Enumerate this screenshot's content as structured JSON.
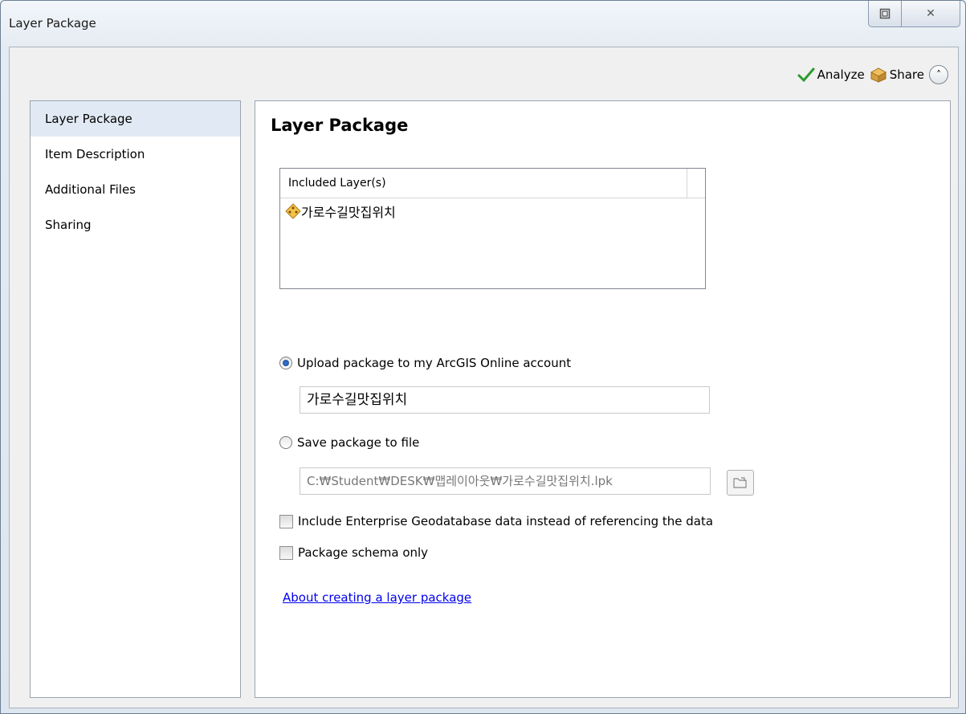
{
  "window": {
    "title": "Layer Package",
    "restore_icon": "restore-icon",
    "close_icon": "close-icon",
    "close_glyph": "✕"
  },
  "toolbar": {
    "analyze_label": "Analyze",
    "share_label": "Share",
    "collapse_glyph": "˄"
  },
  "nav": {
    "items": [
      {
        "label": "Layer Package",
        "selected": true
      },
      {
        "label": "Item Description",
        "selected": false
      },
      {
        "label": "Additional Files",
        "selected": false
      },
      {
        "label": "Sharing",
        "selected": false
      }
    ]
  },
  "main": {
    "title": "Layer Package",
    "layers_header": "Included Layer(s)",
    "layers": [
      {
        "name": "가로수길맛집위치",
        "icon": "point-layer-icon"
      }
    ],
    "upload_option": {
      "label": "Upload package to my ArcGIS Online account",
      "checked": true
    },
    "upload_name_value": "가로수길맛집위치",
    "save_option": {
      "label": "Save package to file",
      "checked": false
    },
    "save_path_value": "C:₩Student₩DESK₩맵레이아웃₩가로수길맛집위치.lpk",
    "include_enterprise": {
      "label": "Include Enterprise Geodatabase data instead of referencing the data",
      "checked": false
    },
    "schema_only": {
      "label": "Package schema only",
      "checked": false
    },
    "help_link": "About creating a layer package"
  },
  "colors": {
    "accent_check": "#2e9a2e",
    "link": "#0000ee",
    "nav_selected": "#e1eaf4"
  }
}
